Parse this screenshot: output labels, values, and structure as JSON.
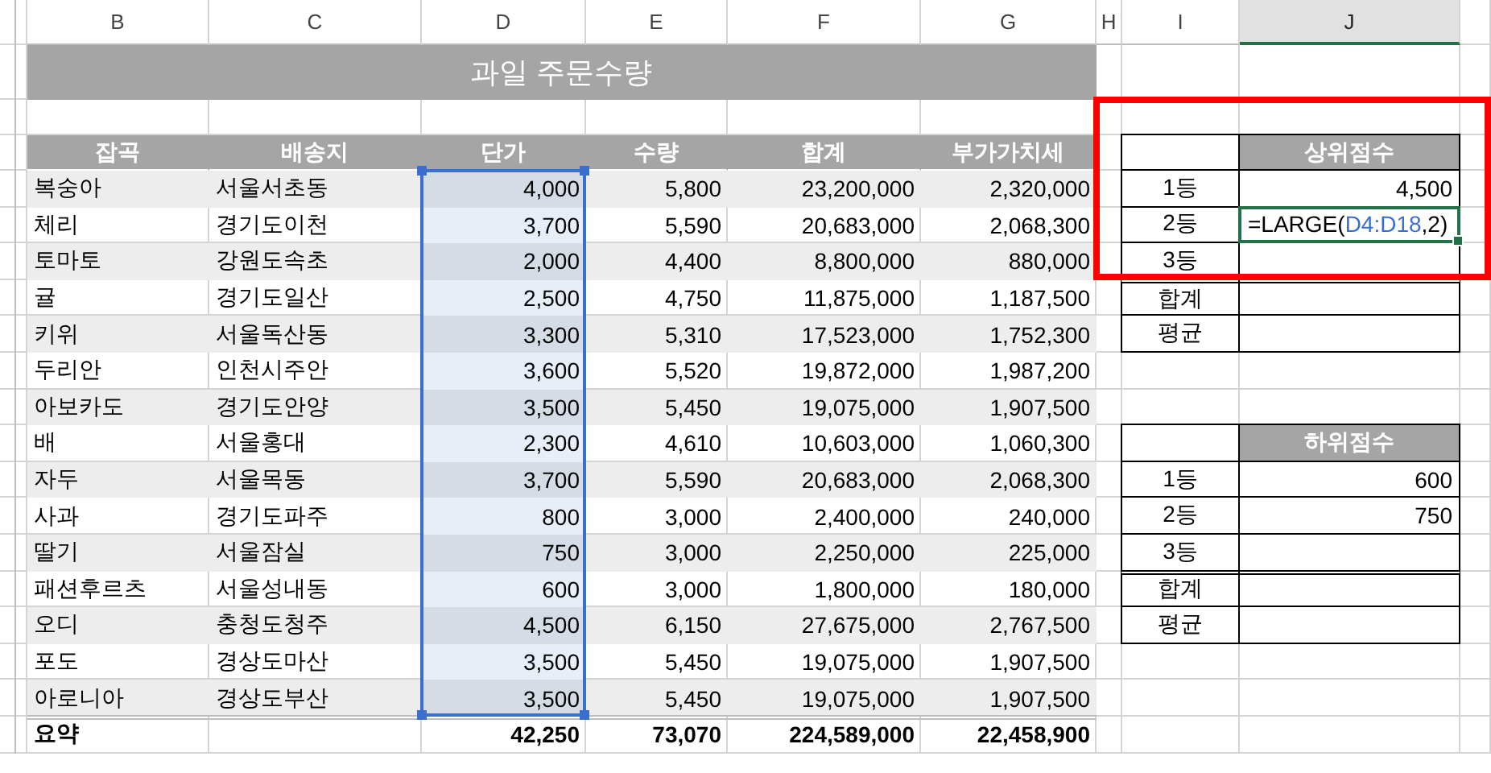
{
  "column_headers": [
    {
      "label": "B",
      "selected": false
    },
    {
      "label": "C",
      "selected": false
    },
    {
      "label": "D",
      "selected": false
    },
    {
      "label": "E",
      "selected": false
    },
    {
      "label": "F",
      "selected": false
    },
    {
      "label": "G",
      "selected": false
    },
    {
      "label": "H",
      "selected": false
    },
    {
      "label": "I",
      "selected": false
    },
    {
      "label": "J",
      "selected": true
    }
  ],
  "title": "과일 주문수량",
  "table": {
    "columns": [
      {
        "label": "잡곡",
        "selected": false
      },
      {
        "label": "배송지",
        "selected": false
      },
      {
        "label": "단가",
        "selected": true
      },
      {
        "label": "수량",
        "selected": false
      },
      {
        "label": "합계",
        "selected": false
      },
      {
        "label": "부가가치세",
        "selected": false
      }
    ],
    "rows": [
      [
        "복숭아",
        "서울서초동",
        "4,000",
        "5,800",
        "23,200,000",
        "2,320,000"
      ],
      [
        "체리",
        "경기도이천",
        "3,700",
        "5,590",
        "20,683,000",
        "2,068,300"
      ],
      [
        "토마토",
        "강원도속초",
        "2,000",
        "4,400",
        "8,800,000",
        "880,000"
      ],
      [
        "귤",
        "경기도일산",
        "2,500",
        "4,750",
        "11,875,000",
        "1,187,500"
      ],
      [
        "키위",
        "서울독산동",
        "3,300",
        "5,310",
        "17,523,000",
        "1,752,300"
      ],
      [
        "두리안",
        "인천시주안",
        "3,600",
        "5,520",
        "19,872,000",
        "1,987,200"
      ],
      [
        "아보카도",
        "경기도안양",
        "3,500",
        "5,450",
        "19,075,000",
        "1,907,500"
      ],
      [
        "배",
        "서울홍대",
        "2,300",
        "4,610",
        "10,603,000",
        "1,060,300"
      ],
      [
        "자두",
        "서울목동",
        "3,700",
        "5,590",
        "20,683,000",
        "2,068,300"
      ],
      [
        "사과",
        "경기도파주",
        "800",
        "3,000",
        "2,400,000",
        "240,000"
      ],
      [
        "딸기",
        "서울잠실",
        "750",
        "3,000",
        "2,250,000",
        "225,000"
      ],
      [
        "패션후르츠",
        "서울성내동",
        "600",
        "3,000",
        "1,800,000",
        "180,000"
      ],
      [
        "오디",
        "충청도청주",
        "4,500",
        "6,150",
        "27,675,000",
        "2,767,500"
      ],
      [
        "포도",
        "경상도마산",
        "3,500",
        "5,450",
        "19,075,000",
        "1,907,500"
      ],
      [
        "아로니아",
        "경상도부산",
        "3,500",
        "5,450",
        "19,075,000",
        "1,907,500"
      ]
    ],
    "summary": {
      "label": "요약",
      "values": [
        "42,250",
        "73,070",
        "224,589,000",
        "22,458,900"
      ]
    }
  },
  "top_scores": {
    "header": "상위점수",
    "highlighted": true,
    "rows": [
      {
        "label": "1등",
        "value": "4,500",
        "editing": false
      },
      {
        "label": "2등",
        "editing": true,
        "formula": {
          "function": "=LARGE(",
          "reference": "D4:D18",
          "rest": ",2)"
        }
      },
      {
        "label": "3등",
        "editing": false
      },
      {
        "label": "합계",
        "editing": false
      },
      {
        "label": "평균",
        "editing": false
      }
    ]
  },
  "bottom_scores": {
    "header": "하위점수",
    "rows": [
      {
        "label": "1등",
        "value": "600",
        "editing": false
      },
      {
        "label": "2등",
        "value": "750",
        "editing": false
      },
      {
        "label": "3등",
        "editing": false
      },
      {
        "label": "합계",
        "editing": false
      },
      {
        "label": "평균",
        "editing": false
      }
    ]
  }
}
